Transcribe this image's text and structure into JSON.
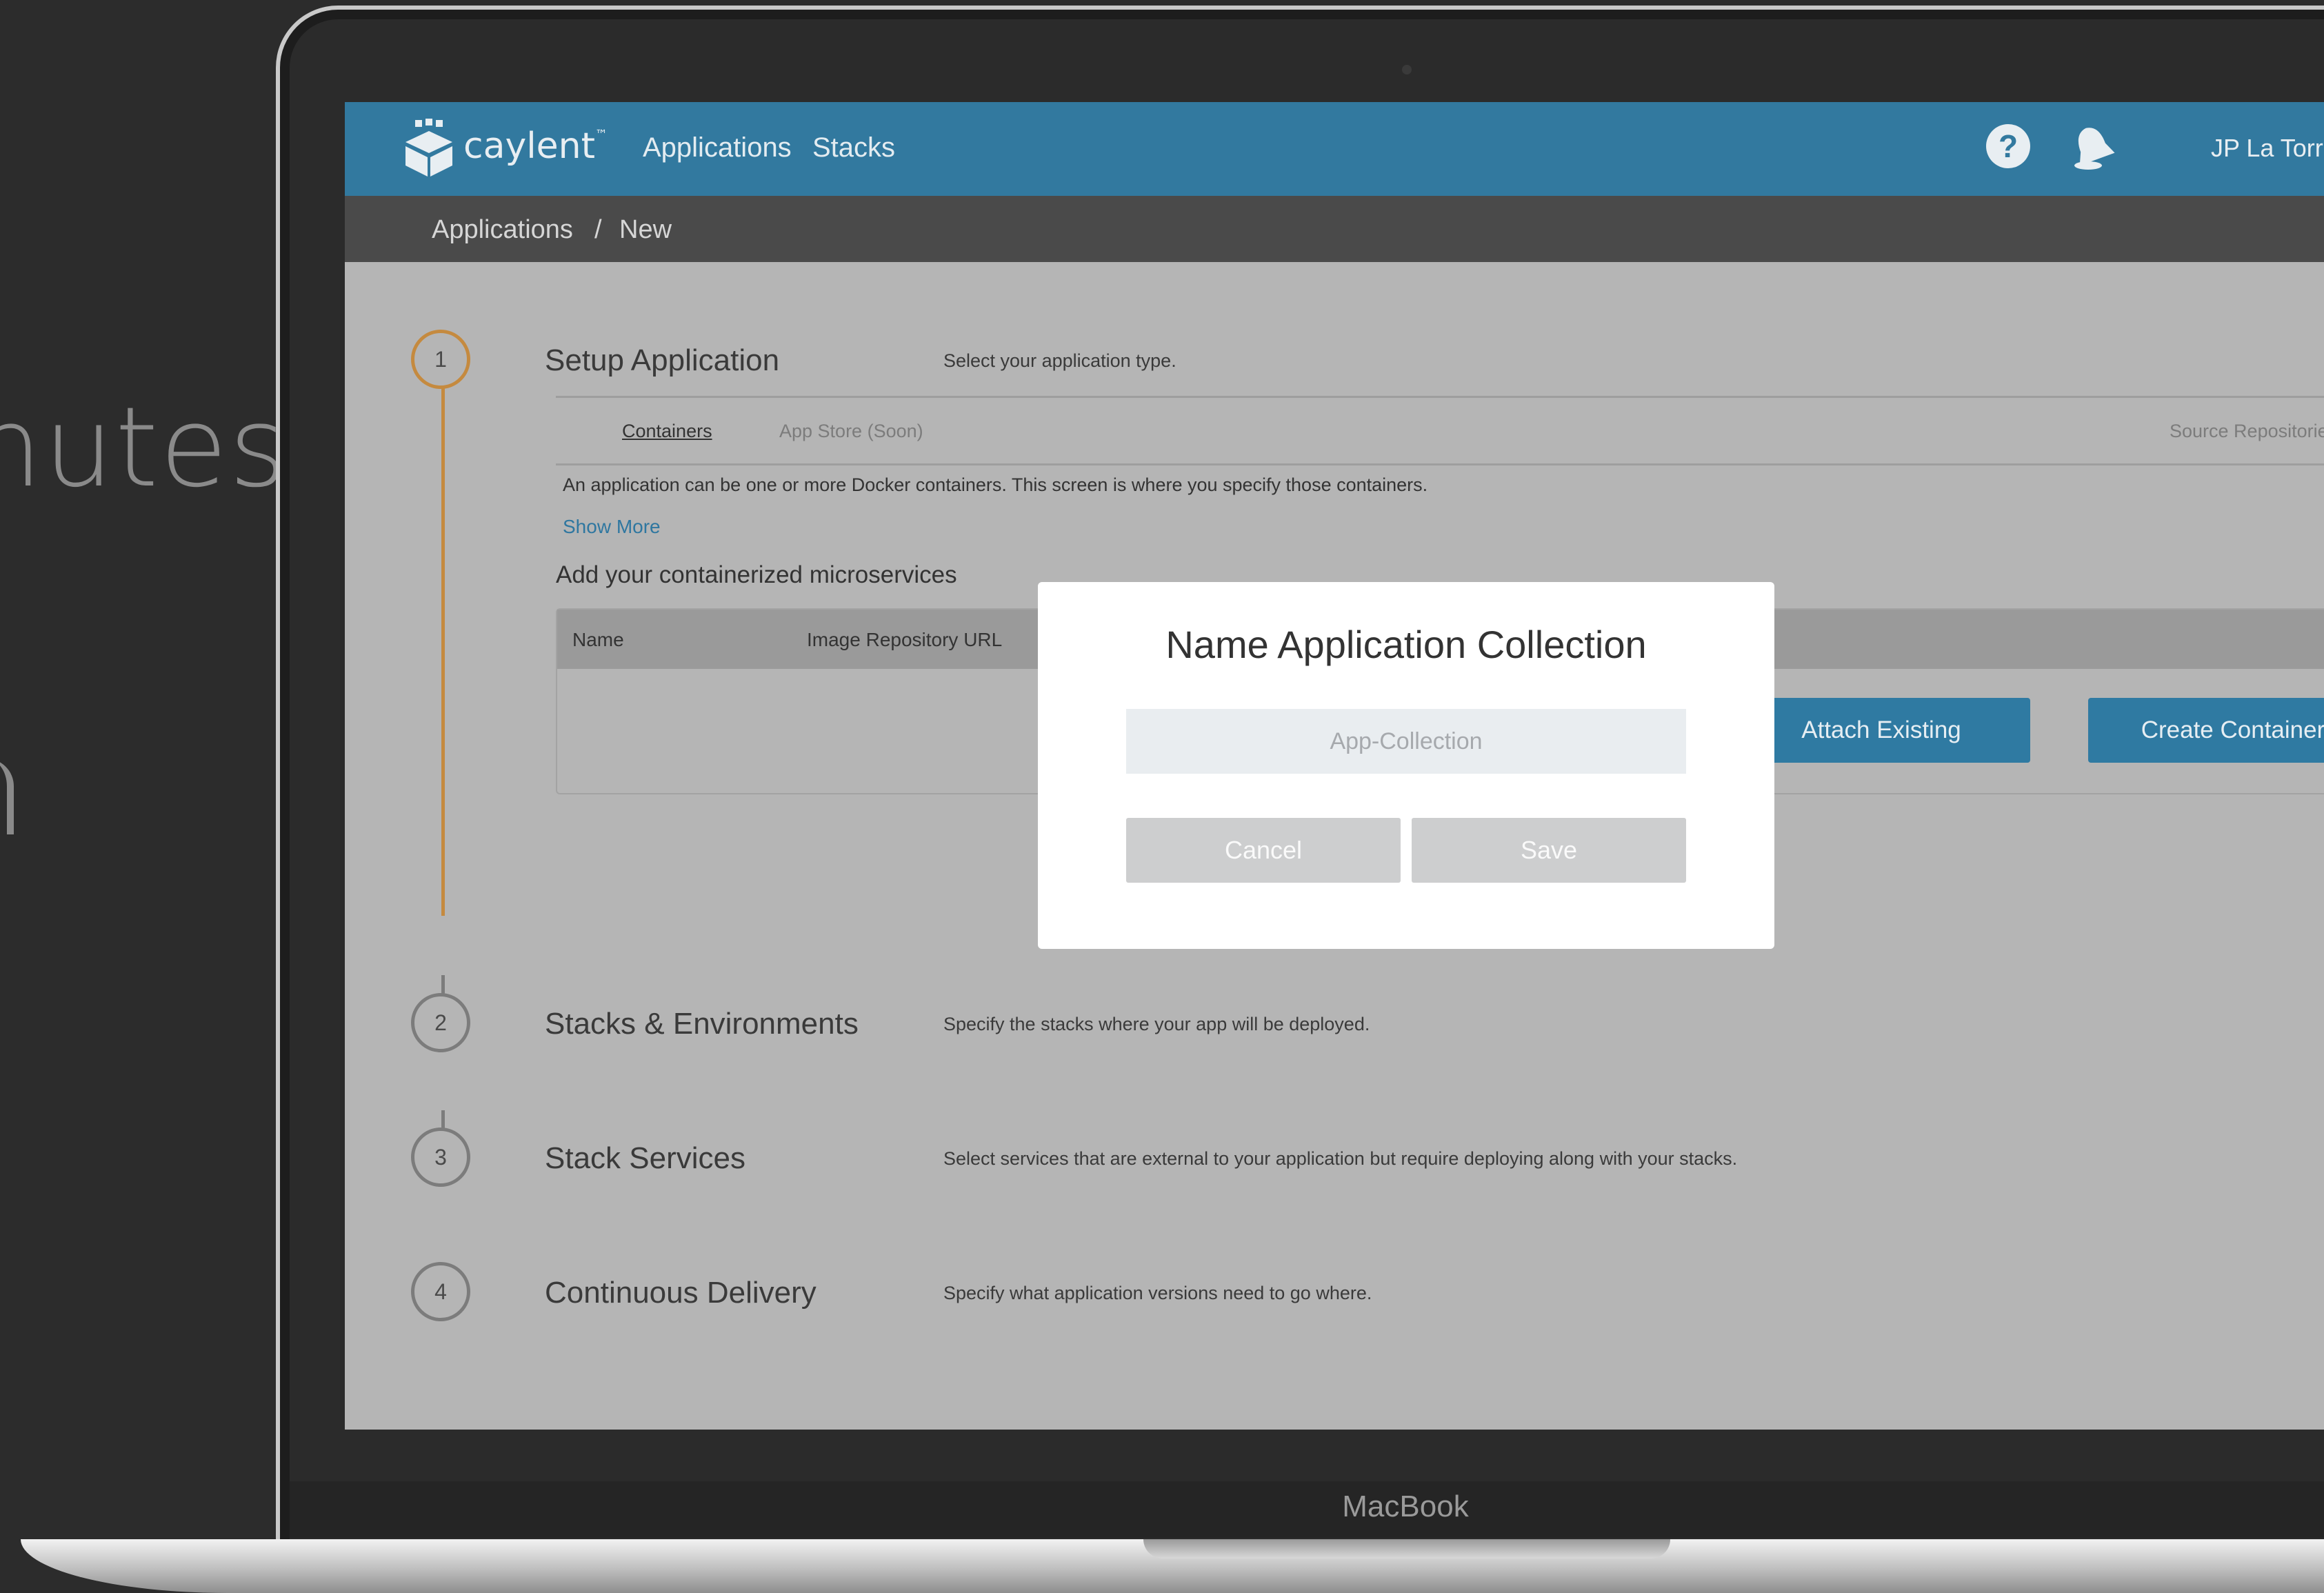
{
  "background": {
    "word": "nutes"
  },
  "device": {
    "label": "MacBook"
  },
  "app": {
    "brand": "caylent",
    "brand_mark": "™",
    "nav": [
      "Applications",
      "Stacks"
    ],
    "user": "JP La Torre"
  },
  "breadcrumb": {
    "root": "Applications",
    "separator": "/",
    "current": "New"
  },
  "steps": [
    {
      "number": "1",
      "title": "Setup Application",
      "desc": "Select your application type."
    },
    {
      "number": "2",
      "title": "Stacks & Environments",
      "desc": "Specify the stacks where your app will be deployed."
    },
    {
      "number": "3",
      "title": "Stack Services",
      "desc": "Select services that are external to your application but require deploying along with your stacks."
    },
    {
      "number": "4",
      "title": "Continuous Delivery",
      "desc": "Specify what application versions need to go where."
    }
  ],
  "setup": {
    "tabs": {
      "containers": "Containers",
      "app_store": "App Store (Soon)",
      "source_repos": "Source Repositories"
    },
    "description": "An application can be one or more Docker containers. This screen is where you specify those containers.",
    "show_more": "Show More",
    "subheading": "Add your containerized microservices",
    "table_headers": {
      "name": "Name",
      "image_url": "Image Repository URL"
    },
    "attach_existing": "Attach Existing",
    "create_container": "Create Container"
  },
  "modal": {
    "title": "Name Application Collection",
    "input_placeholder": "App-Collection",
    "cancel": "Cancel",
    "save": "Save"
  },
  "colors": {
    "topbar": "#32799f",
    "accent_orange": "#c58a3f",
    "button_blue": "#2f7aa2"
  }
}
